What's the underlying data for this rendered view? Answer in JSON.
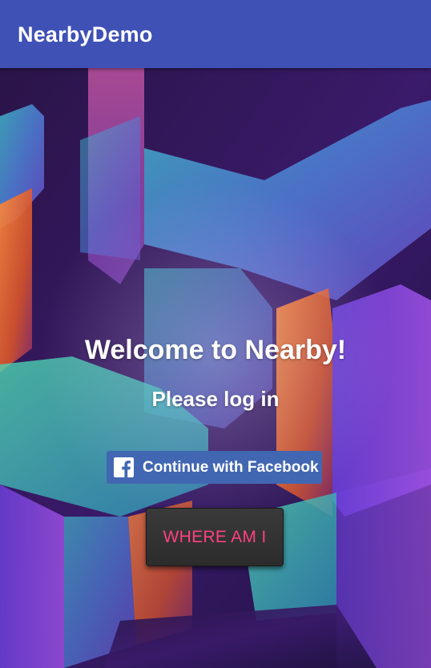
{
  "app": {
    "title": "NearbyDemo"
  },
  "main": {
    "welcome_text": "Welcome to Nearby!",
    "prompt_text": "Please log in",
    "facebook_button_label": "Continue with Facebook",
    "facebook_icon": "facebook-logo-icon",
    "where_button_label": "WHERE AM I"
  },
  "colors": {
    "toolbar": "#3f51b5",
    "facebook_blue": "#4267b2",
    "accent_pink": "#ff4081",
    "button_dark": "#333333"
  }
}
